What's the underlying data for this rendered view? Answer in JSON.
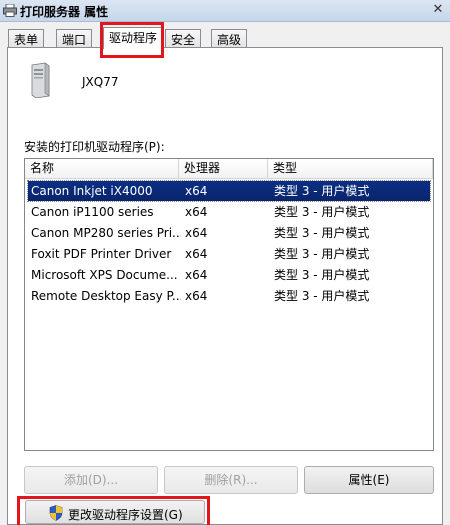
{
  "window": {
    "title": "打印服务器 属性",
    "close_glyph": "✕"
  },
  "tabs": [
    {
      "label": "表单"
    },
    {
      "label": "端口"
    },
    {
      "label": "驱动程序"
    },
    {
      "label": "安全"
    },
    {
      "label": "高级"
    }
  ],
  "active_tab": "驱动程序",
  "server": {
    "name": "JXQ77"
  },
  "drivers_section": {
    "label": "安装的打印机驱动程序(P):",
    "columns": [
      "名称",
      "处理器",
      "类型"
    ],
    "rows": [
      {
        "name": "Canon Inkjet iX4000",
        "processor": "x64",
        "type": "类型 3 - 用户模式"
      },
      {
        "name": "Canon iP1100 series",
        "processor": "x64",
        "type": "类型 3 - 用户模式"
      },
      {
        "name": "Canon MP280 series Pri...",
        "processor": "x64",
        "type": "类型 3 - 用户模式"
      },
      {
        "name": "Foxit PDF Printer Driver",
        "processor": "x64",
        "type": "类型 3 - 用户模式"
      },
      {
        "name": "Microsoft XPS Docume...",
        "processor": "x64",
        "type": "类型 3 - 用户模式"
      },
      {
        "name": "Remote Desktop Easy P...",
        "processor": "x64",
        "type": "类型 3 - 用户模式"
      }
    ],
    "selected_index": 0
  },
  "buttons": {
    "add_label": "添加(D)...",
    "remove_label": "删除(R)...",
    "properties_label": "属性(E)",
    "change_settings_label": "更改驱动程序设置(G)"
  },
  "colors": {
    "highlight_border": "#e3161b",
    "selection": "#0a246a"
  }
}
